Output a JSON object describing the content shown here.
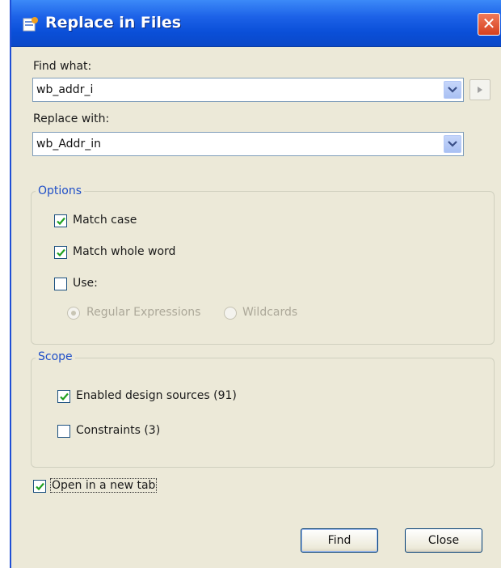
{
  "window": {
    "title": "Replace in Files",
    "close_glyph": "✕"
  },
  "find": {
    "label": "Find what:",
    "value": "wb_addr_i"
  },
  "replace": {
    "label": "Replace with:",
    "value": "wb_Addr_in"
  },
  "options": {
    "title": "Options",
    "match_case": {
      "label": "Match case",
      "checked": true
    },
    "match_whole_word": {
      "label": "Match whole word",
      "checked": true
    },
    "use": {
      "label": "Use:",
      "checked": false
    },
    "regex_label": "Regular Expressions",
    "wildcards_label": "Wildcards",
    "selected_mode": "Regular Expressions"
  },
  "scope": {
    "title": "Scope",
    "design_sources": {
      "label": "Enabled design sources (91)",
      "checked": true
    },
    "constraints": {
      "label": "Constraints (3)",
      "checked": false
    }
  },
  "open_new_tab": {
    "label": "Open in a new tab",
    "checked": true
  },
  "buttons": {
    "find": "Find",
    "close": "Close"
  },
  "colors": {
    "titlebar": "#0a4fd8",
    "dialog_bg": "#ece9d8",
    "group_label": "#1f4fc8",
    "check": "#21a121"
  }
}
